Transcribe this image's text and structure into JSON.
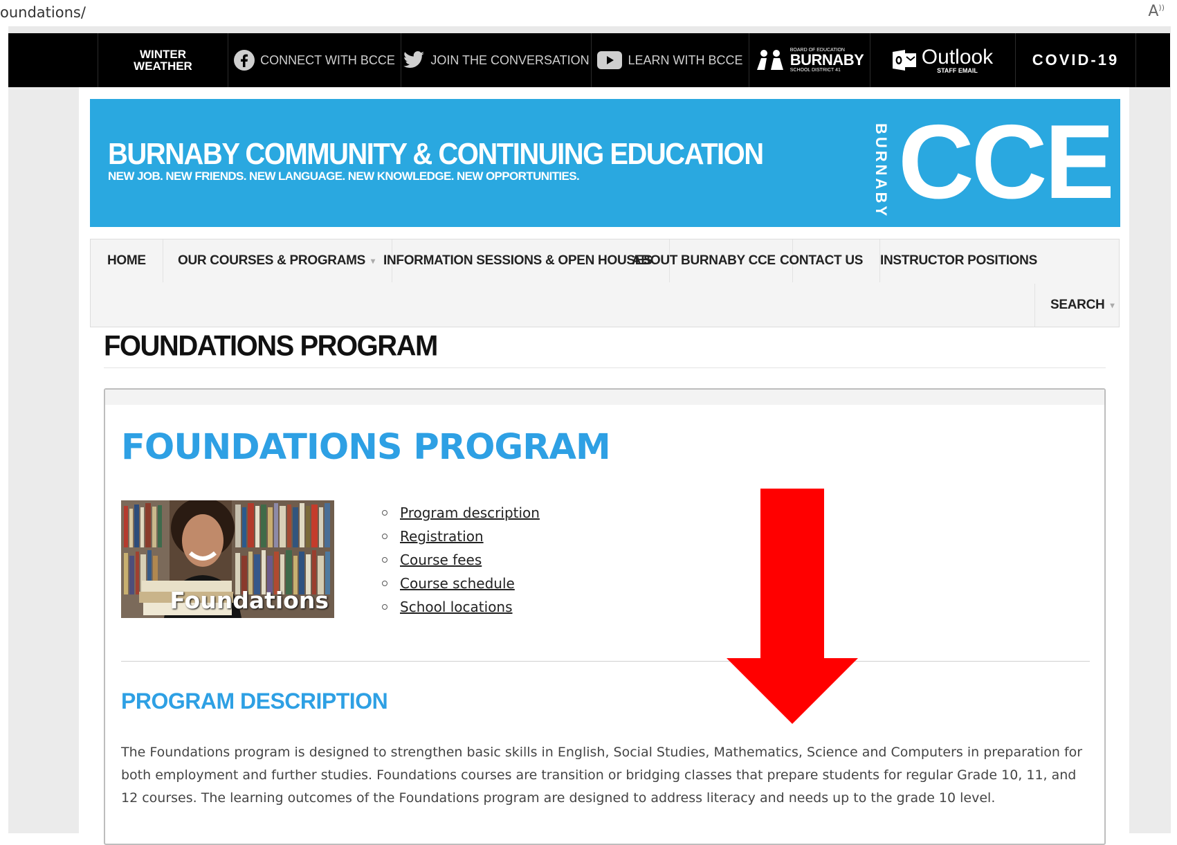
{
  "address_bar": {
    "url": "oundations/",
    "reader_icon": "reader-view-icon"
  },
  "topbar": {
    "winter_line1": "WINTER",
    "winter_line2": "WEATHER",
    "connect": "CONNECT WITH BCCE",
    "join": "JOIN THE CONVERSATION",
    "learn": "LEARN WITH BCCE",
    "burnaby_small": "BOARD OF EDUCATION",
    "burnaby_big": "BURNABY",
    "burnaby_sub": "SCHOOL DISTRICT 41",
    "outlook": "Outlook",
    "outlook_sub": "STAFF EMAIL",
    "covid": "COVID-19"
  },
  "banner": {
    "title": "BURNABY COMMUNITY & CONTINUING EDUCATION",
    "tagline": "NEW JOB. NEW FRIENDS. NEW LANGUAGE. NEW KNOWLEDGE. NEW OPPORTUNITIES.",
    "vertical_word": "BURNABY",
    "logo": "CCE"
  },
  "nav": {
    "home": "HOME",
    "courses": "OUR COURSES & PROGRAMS",
    "info": "INFORMATION SESSIONS & OPEN HOUSES",
    "about": "ABOUT BURNABY CCE",
    "contact": "CONTACT US",
    "instructor": "INSTRUCTOR POSITIONS",
    "search": "SEARCH"
  },
  "page_heading": "FOUNDATIONS PROGRAM",
  "content": {
    "heading": "FOUNDATIONS PROGRAM",
    "image_caption": "Foundations",
    "links": [
      "Program description",
      "Registration",
      "Course fees",
      "Course schedule",
      "School locations"
    ],
    "section_heading": "PROGRAM DESCRIPTION",
    "paragraph": "The Foundations program is designed to strengthen basic skills in English, Social Studies, Mathematics, Science and Computers in preparation for both employment and further studies. Foundations courses are transition or bridging classes that prepare students for regular Grade 10, 11, and 12 courses. The learning outcomes of the Foundations program are designed to address literacy and needs up to the grade 10 level."
  },
  "colors": {
    "accent_blue": "#2aa8e0",
    "heading_blue": "#2ea0e4",
    "arrow_red": "#ff0000",
    "topbar": "#000000"
  }
}
